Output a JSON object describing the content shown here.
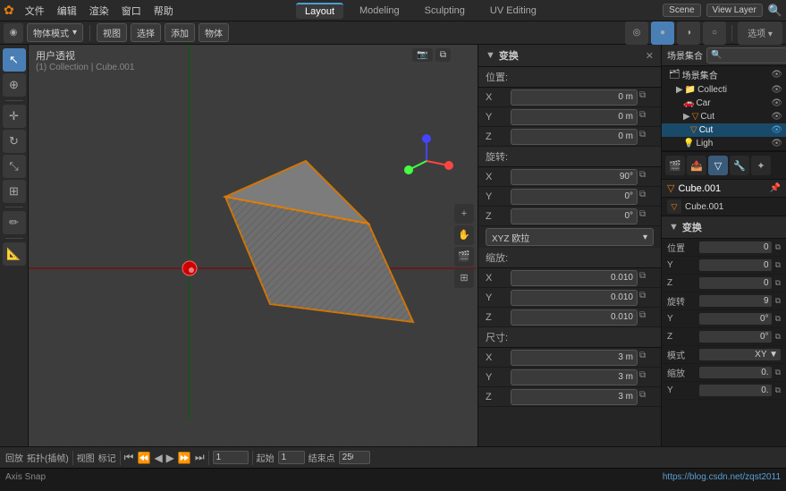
{
  "app": {
    "title": "Blender",
    "scene_name": "Scene",
    "view_layer": "View Layer"
  },
  "menu": {
    "items": [
      "文件",
      "编辑",
      "渲染",
      "窗口",
      "帮助"
    ]
  },
  "tabs": {
    "items": [
      "Layout",
      "Modeling",
      "Sculpting",
      "UV Editing"
    ],
    "active": "Layout",
    "right_label": "选项 ▼"
  },
  "toolbar2": {
    "mode": "物体模式",
    "view": "视图",
    "select": "选择",
    "add": "添加",
    "object": "物体"
  },
  "viewport": {
    "view_name": "用户透视",
    "collection_label": "(1) Collection | Cube.001"
  },
  "transform_panel": {
    "title": "变换",
    "position_label": "位置:",
    "pos_x": "0 m",
    "pos_y": "0 m",
    "pos_z": "0 m",
    "rotation_label": "旋转:",
    "rot_x": "90°",
    "rot_y": "0°",
    "rot_z": "0°",
    "euler_label": "XYZ 欧拉",
    "scale_label": "缩放:",
    "scale_x": "0.010",
    "scale_y": "0.010",
    "scale_z": "0.010",
    "dimensions_label": "尺寸:",
    "dim_x": "3 m",
    "dim_y": "3 m",
    "dim_z": "3 m",
    "x_label": "X",
    "y_label": "Y",
    "z_label": "Z"
  },
  "bottom_bar": {
    "playback": "回放",
    "keying": "拓扑(插帧)",
    "view": "视图",
    "marker": "标记",
    "start": "起始",
    "start_val": "1",
    "end_label": "结束点",
    "end_val": "250",
    "current_frame": "1"
  },
  "status_bar": {
    "action": "Axis Snap",
    "url": "https://blog.csdn.net/zqst2011"
  },
  "outliner": {
    "title": "场景集合",
    "items": [
      {
        "name": "Collecti",
        "indent": 1,
        "icon": "📁",
        "eye": true
      },
      {
        "name": "Car",
        "indent": 2,
        "icon": "🚗",
        "eye": true
      },
      {
        "name": "Cut",
        "indent": 2,
        "icon": "▽",
        "eye": true
      },
      {
        "name": "Cut",
        "indent": 3,
        "icon": "▽",
        "eye": true,
        "selected": true
      },
      {
        "name": "Ligh",
        "indent": 2,
        "icon": "💡",
        "eye": true
      }
    ]
  },
  "properties_panel": {
    "object_name": "Cube.001",
    "mesh_name": "Cube.001",
    "transform_title": "变换",
    "pos_label": "位置",
    "pos_x": "0",
    "pos_y": "0",
    "pos_z": "0",
    "rot_label": "旋转",
    "rot_x": "9",
    "rot_y": "0°",
    "rot_z": "0°",
    "mode_label": "模式",
    "mode_val": "XY ▼",
    "scale_label": "缩放",
    "scale_x": "0.",
    "scale_y": "0."
  },
  "icons": {
    "arrow_right": "▶",
    "arrow_down": "▼",
    "close": "✕",
    "copy": "⧉",
    "search": "🔍",
    "eye": "👁",
    "wrench": "🔧",
    "constraint": "🔗",
    "particle": "✦",
    "physics": "⚡",
    "object_data": "▽",
    "material": "●",
    "chevron_down": "▾"
  }
}
